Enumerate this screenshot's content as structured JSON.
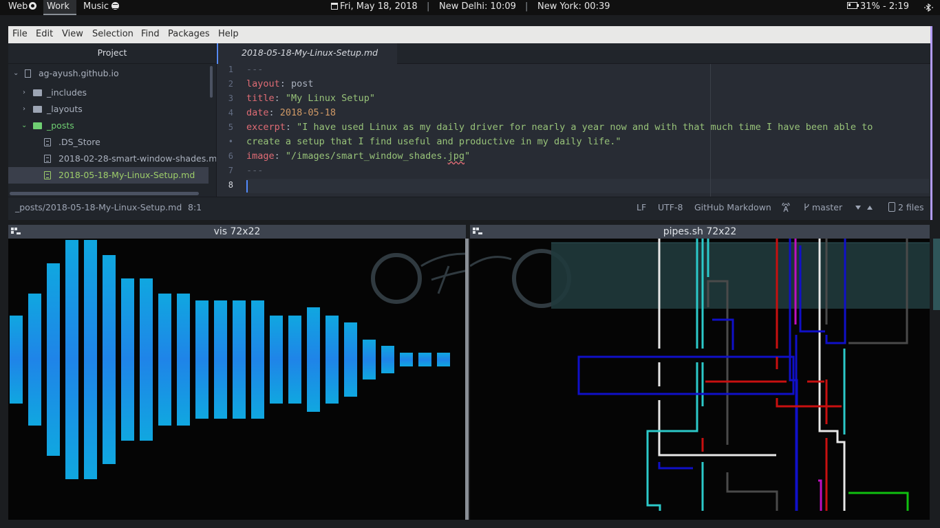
{
  "panel": {
    "workspaces": [
      {
        "label": "Web",
        "active": false
      },
      {
        "label": "Work",
        "active": true
      },
      {
        "label": "Music",
        "active": false
      }
    ],
    "date": "Fri, May 18, 2018",
    "clock_delhi": "New Delhi: 10:09",
    "clock_ny": "New York: 00:39",
    "battery": "31% - 2:19",
    "separator": "|"
  },
  "editor": {
    "menu": [
      "File",
      "Edit",
      "View",
      "Selection",
      "Find",
      "Packages",
      "Help"
    ],
    "project_title": "Project",
    "tree": [
      {
        "label": "ag-ayush.github.io",
        "type": "repo"
      },
      {
        "label": "_includes",
        "type": "folder"
      },
      {
        "label": "_layouts",
        "type": "folder"
      },
      {
        "label": "_posts",
        "type": "folder-open"
      },
      {
        "label": ".DS_Store",
        "type": "file"
      },
      {
        "label": "2018-02-28-smart-window-shades.md",
        "type": "file"
      },
      {
        "label": "2018-05-18-My-Linux-Setup.md",
        "type": "file-selected"
      }
    ],
    "tab_title": "2018-05-18-My-Linux-Setup.md",
    "line_numbers": [
      "1",
      "2",
      "3",
      "4",
      "5",
      "•",
      "6",
      "7",
      "8"
    ],
    "code": {
      "l1": "---",
      "l2_key": "layout",
      "l2_val": "post",
      "l3_key": "title",
      "l3_val": "\"My Linux Setup\"",
      "l4_key": "date",
      "l4_val": "2018-05-18",
      "l5_key": "excerpt",
      "l5_val": "\"I have used Linux as my daily driver for nearly a year now and with that much time I have been able to",
      "l5b": "create a setup that I find useful and productive in my daily life.\"",
      "l6_key": "image",
      "l6_pre": "\"/images/smart_window_shades.",
      "l6_ext": "jpg",
      "l6_post": "\"",
      "l7": "---",
      "colon": ": "
    },
    "status": {
      "path": "_posts/2018-05-18-My-Linux-Setup.md",
      "cursor": "8:1",
      "line_ending": "LF",
      "encoding": "UTF-8",
      "grammar": "GitHub Markdown",
      "branch": "master",
      "files": "2 files"
    }
  },
  "terminals": {
    "left_title": "vis 72x22",
    "right_title": "pipes.sh 72x22",
    "vis_levels": [
      0.26,
      0.39,
      0.57,
      0.71,
      0.71,
      0.62,
      0.48,
      0.48,
      0.39,
      0.39,
      0.35,
      0.35,
      0.35,
      0.35,
      0.26,
      0.26,
      0.31,
      0.26,
      0.22,
      0.12,
      0.08,
      0.04,
      0.04,
      0.04
    ]
  },
  "colors": {
    "accent": "#568af2",
    "vis_bar_top": "#10a7e0",
    "vis_bar": "#1f84e8",
    "string": "#98c379",
    "keyword": "#e06c75",
    "number": "#d19a66"
  }
}
